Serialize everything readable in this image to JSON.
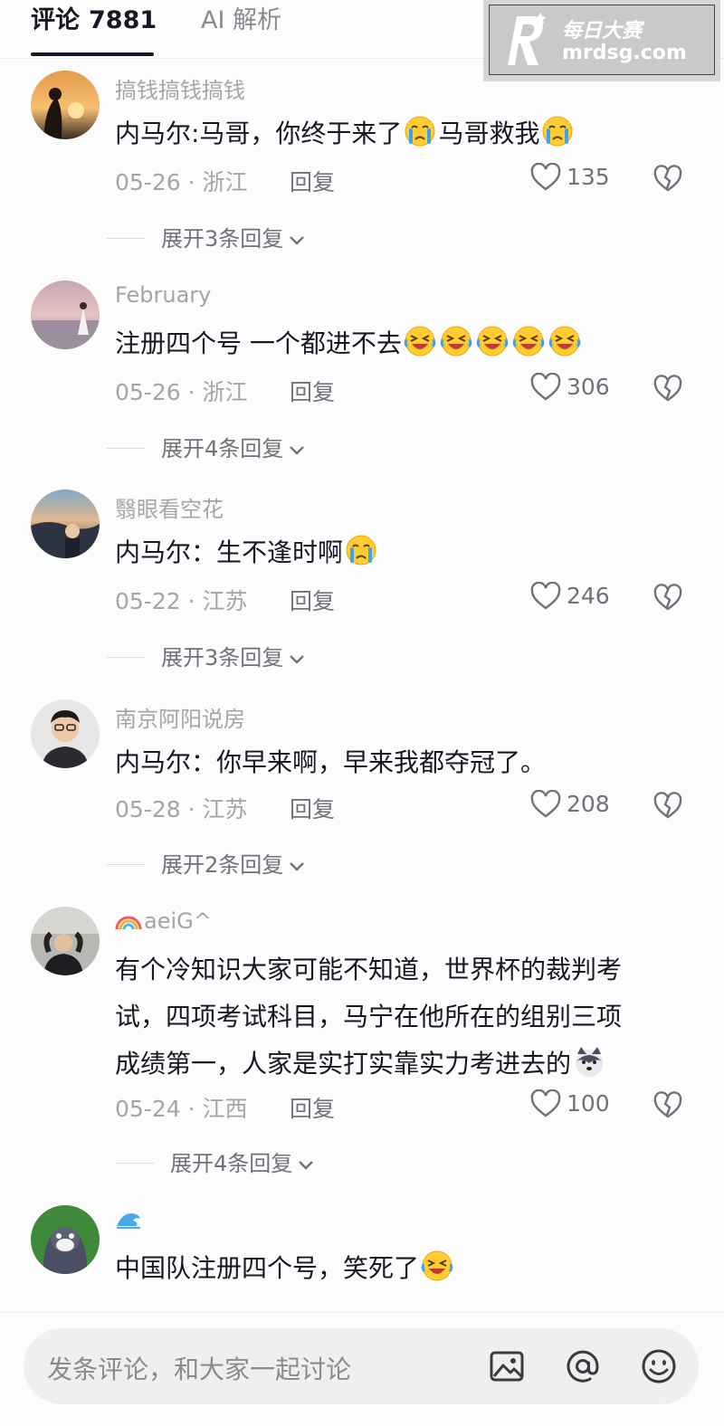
{
  "tabs": {
    "comments_label": "评论",
    "comments_count": "7881",
    "ai_label": "AI 解析"
  },
  "watermark": {
    "chinese": "每日大赛",
    "url": "mrdsg.com"
  },
  "comments": [
    {
      "username": "搞钱搞钱搞钱",
      "text": "内马尔:马哥，你终于来了",
      "text2": "马哥救我",
      "date": "05-26",
      "location": "浙江",
      "reply": "回复",
      "likes": "135",
      "expand": "展开3条回复"
    },
    {
      "username": "February",
      "text": "注册四个号 一个都进不去",
      "date": "05-26",
      "location": "浙江",
      "reply": "回复",
      "likes": "306",
      "expand": "展开4条回复"
    },
    {
      "username": "翳眼看空花",
      "text": "内马尔：生不逢时啊",
      "date": "05-22",
      "location": "江苏",
      "reply": "回复",
      "likes": "246",
      "expand": "展开3条回复"
    },
    {
      "username": "南京阿阳说房",
      "text": "内马尔：你早来啊，早来我都夺冠了。",
      "date": "05-28",
      "location": "江苏",
      "reply": "回复",
      "likes": "208",
      "expand": "展开2条回复"
    },
    {
      "username": "aeiG^",
      "line1": "有个冷知识大家可能不知道，世界杯的裁判考",
      "line2": "试，四项考试科目，马宁在他所在的组别三项",
      "line3": "成绩第一，人家是实打实靠实力考进去的",
      "date": "05-24",
      "location": "江西",
      "reply": "回复",
      "likes": "100",
      "expand": "展开4条回复"
    },
    {
      "username": "",
      "text": "中国队注册四个号，笑死了"
    }
  ],
  "bottom_bar": {
    "placeholder": "发条评论，和大家一起讨论"
  },
  "icons": {
    "like": "heart-outline-icon",
    "dislike": "broken-heart-icon",
    "expand": "chevron-down-icon",
    "image": "image-icon",
    "mention": "at-sign-icon",
    "emoji": "smiley-icon"
  },
  "colors": {
    "text_primary": "#161823",
    "text_secondary": "#a4a5aa",
    "background": "#fcfcfc"
  }
}
